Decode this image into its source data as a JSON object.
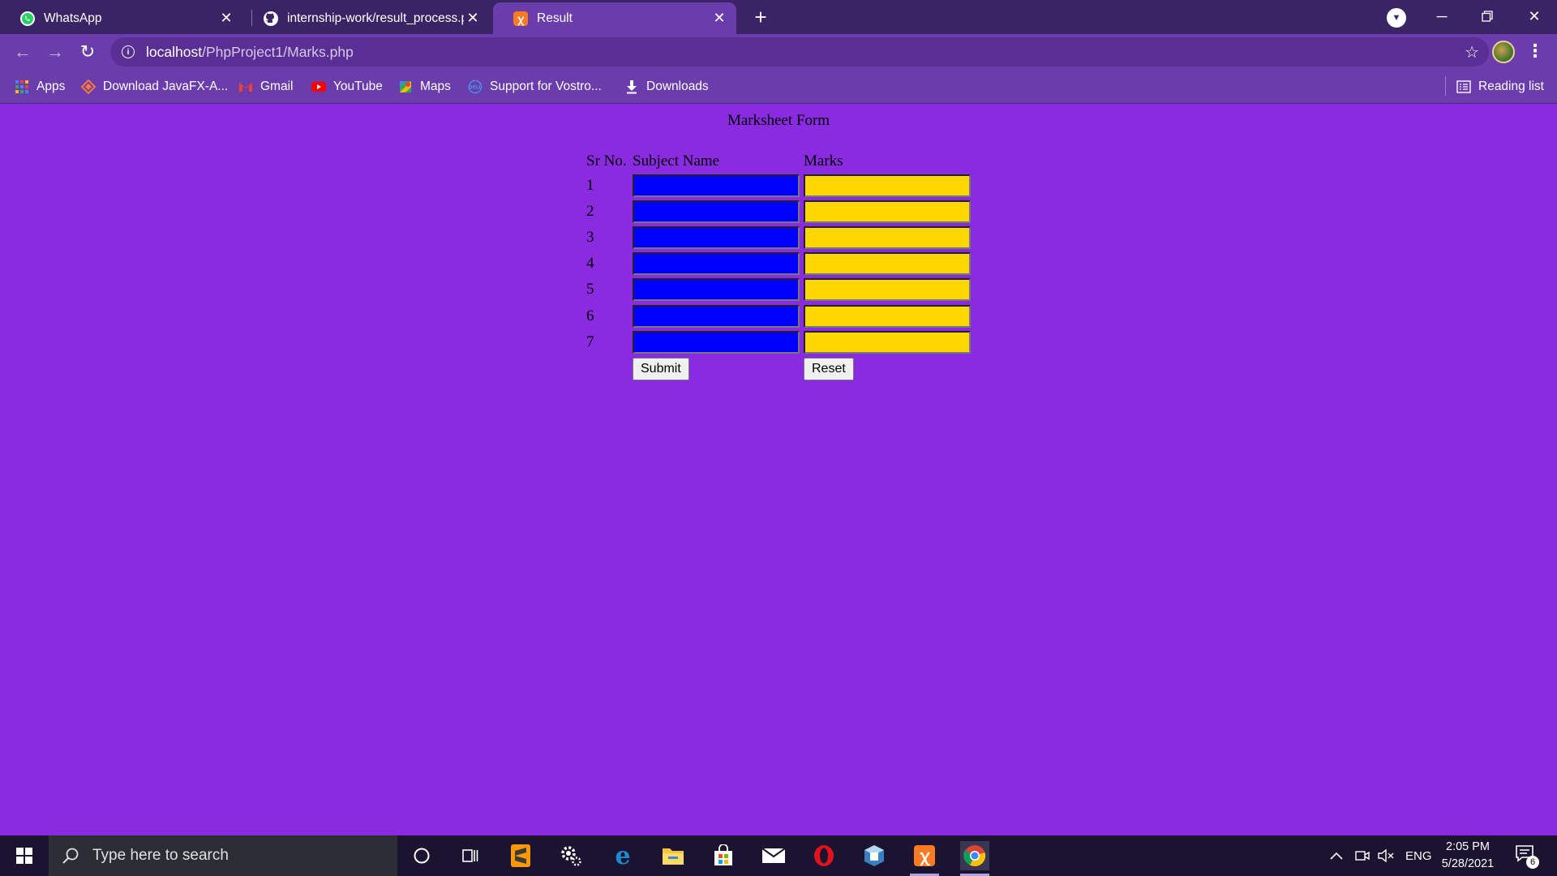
{
  "browser": {
    "tabs": [
      {
        "title": "WhatsApp",
        "icon": "whatsapp-icon"
      },
      {
        "title": "internship-work/result_process.php",
        "icon": "github-icon"
      },
      {
        "title": "Result",
        "icon": "xampp-icon"
      }
    ],
    "url_host": "localhost",
    "url_path": "/PhpProject1/Marks.php",
    "bookmarks": [
      {
        "label": "Apps",
        "icon": "apps-grid-icon"
      },
      {
        "label": "Download JavaFX-A...",
        "icon": "javafx-icon"
      },
      {
        "label": "Gmail",
        "icon": "gmail-icon"
      },
      {
        "label": "YouTube",
        "icon": "youtube-icon"
      },
      {
        "label": "Maps",
        "icon": "maps-icon"
      },
      {
        "label": "Support for Vostro...",
        "icon": "dell-icon"
      },
      {
        "label": "Downloads",
        "icon": "download-icon"
      }
    ],
    "reading_list": "Reading list"
  },
  "page": {
    "title": "Marksheet Form",
    "headers": {
      "sr": "Sr No.",
      "subject": "Subject Name",
      "marks": "Marks"
    },
    "rows": [
      {
        "sr": "1",
        "subject": "",
        "marks": ""
      },
      {
        "sr": "2",
        "subject": "",
        "marks": ""
      },
      {
        "sr": "3",
        "subject": "",
        "marks": ""
      },
      {
        "sr": "4",
        "subject": "",
        "marks": ""
      },
      {
        "sr": "5",
        "subject": "",
        "marks": ""
      },
      {
        "sr": "6",
        "subject": "",
        "marks": ""
      },
      {
        "sr": "7",
        "subject": "",
        "marks": ""
      }
    ],
    "submit_label": "Submit",
    "reset_label": "Reset",
    "colors": {
      "background": "#8a2be2",
      "subject_field": "#0000ff",
      "marks_field": "#ffd700"
    }
  },
  "taskbar": {
    "search_placeholder": "Type here to search",
    "language": "ENG",
    "time": "2:05 PM",
    "date": "5/28/2021",
    "notification_count": "6"
  }
}
